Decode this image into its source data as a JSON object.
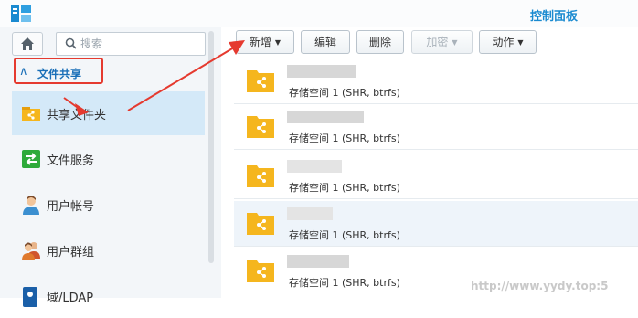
{
  "window": {
    "title": "控制面板"
  },
  "sidebar": {
    "search": {
      "placeholder": "搜索"
    },
    "group": {
      "label": "文件共享"
    },
    "items": [
      {
        "label": "共享文件夹",
        "icon": "shared-folder-icon",
        "active": true
      },
      {
        "label": "文件服务",
        "icon": "file-services-icon"
      },
      {
        "label": "用户帐号",
        "icon": "user-icon"
      },
      {
        "label": "用户群组",
        "icon": "group-icon"
      },
      {
        "label": "域/LDAP",
        "icon": "domain-icon"
      }
    ]
  },
  "toolbar": {
    "create_label": "新增",
    "edit_label": "编辑",
    "delete_label": "删除",
    "encrypt_label": "加密",
    "action_label": "动作"
  },
  "folders": [
    {
      "description": "存储空间 1 (SHR, btrfs)"
    },
    {
      "description": "存储空间 1 (SHR, btrfs)"
    },
    {
      "description": "存储空间 1 (SHR, btrfs)"
    },
    {
      "description": "存储空间 1 (SHR, btrfs)"
    },
    {
      "description": "存储空间 1 (SHR, btrfs)"
    }
  ],
  "watermark": "http://www.yydy.top:5",
  "colors": {
    "accent": "#1a8ad0",
    "folder": "#f5b61e",
    "annotation": "#e53a2f",
    "selected_row": "#eef4fa"
  }
}
